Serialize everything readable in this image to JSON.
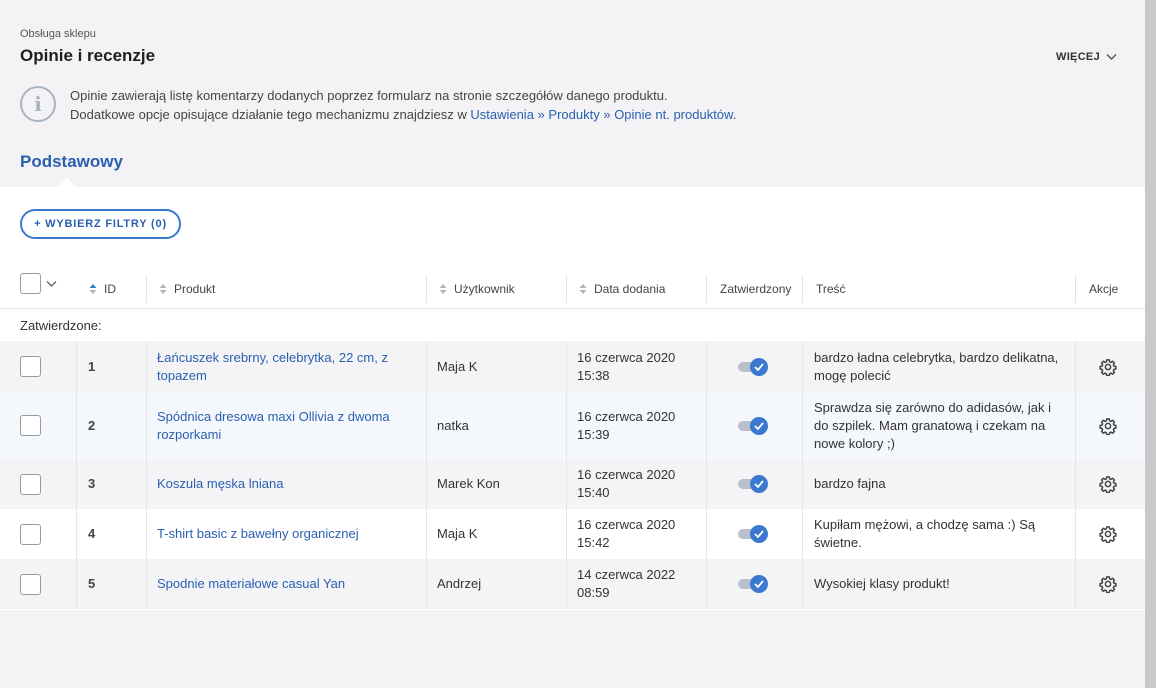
{
  "header": {
    "breadcrumb": "Obsługa sklepu",
    "title": "Opinie i recenzje",
    "more_label": "WIĘCEJ"
  },
  "info": {
    "line1": "Opinie zawierają listę komentarzy dodanych poprzez formularz na stronie szczegółów danego produktu.",
    "line2_prefix": "Dodatkowe opcje opisujące działanie tego mechanizmu znajdziesz w ",
    "link1": "Ustawienia",
    "sep1": " » ",
    "link2": "Produkty",
    "sep2": " » ",
    "link3": "Opinie nt. produktów",
    "line2_suffix": "."
  },
  "tab": {
    "label": "Podstawowy"
  },
  "filter": {
    "label": "+ WYBIERZ FILTRY (0)"
  },
  "table": {
    "headers": {
      "id": "ID",
      "product": "Produkt",
      "user": "Użytkownik",
      "date": "Data dodania",
      "approved": "Zatwierdzony",
      "content": "Treść",
      "actions": "Akcje"
    },
    "group_label": "Zatwierdzone:",
    "rows": [
      {
        "id": "1",
        "product": "Łańcuszek srebrny, celebrytka, 22 cm, z topazem",
        "user": "Maja K",
        "date": "16 czerwca 2020",
        "time": "15:38",
        "approved": true,
        "content": "bardzo ładna celebrytka, bardzo delikatna, mogę polecić"
      },
      {
        "id": "2",
        "product": "Spódnica dresowa maxi Ollivia z dwoma rozporkami",
        "user": "natka",
        "date": "16 czerwca 2020",
        "time": "15:39",
        "approved": true,
        "content": "Sprawdza się zarówno do adidasów, jak i do szpilek. Mam granatową i czekam na nowe kolory ;)"
      },
      {
        "id": "3",
        "product": "Koszula męska lniana",
        "user": "Marek Kon",
        "date": "16 czerwca 2020",
        "time": "15:40",
        "approved": true,
        "content": "bardzo fajna"
      },
      {
        "id": "4",
        "product": "T-shirt basic z bawełny organicznej",
        "user": "Maja K",
        "date": "16 czerwca 2020",
        "time": "15:42",
        "approved": true,
        "content": "Kupiłam mężowi, a chodzę sama :) Są świetne."
      },
      {
        "id": "5",
        "product": "Spodnie materiałowe casual Yan",
        "user": "Andrzej",
        "date": "14 czerwca 2022",
        "time": "08:59",
        "approved": true,
        "content": "Wysokiej klasy produkt!"
      }
    ]
  },
  "colors": {
    "accent": "#3b78d0",
    "link": "#2a5fb0",
    "background": "#f3f3f5"
  }
}
